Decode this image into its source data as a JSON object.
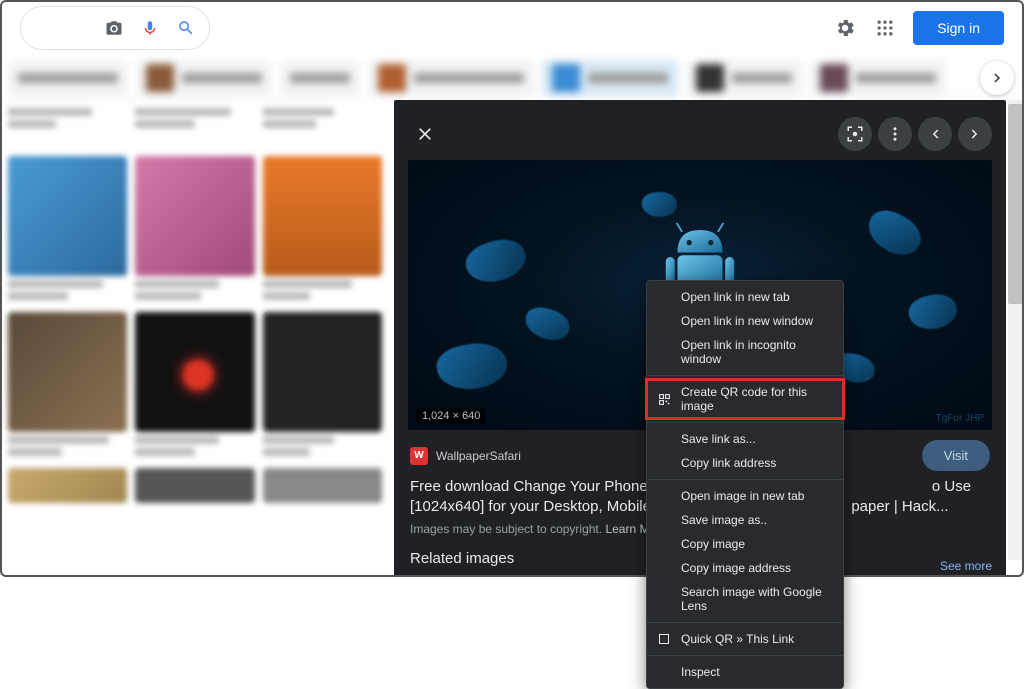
{
  "header": {
    "signin_label": "Sign in"
  },
  "viewer": {
    "dimensions": "1,024 × 640",
    "watermark": "TgFor JHP",
    "source": "WallpaperSafari",
    "favicon_letter": "W",
    "title_line1": "Free download Change Your Phones Boot Anim",
    "title_line2": "[1024x640] for your Desktop, Mobile & Tablet |",
    "title_suffix1": "o Use",
    "title_suffix2": "paper | Hack...",
    "copyright": "Images may be subject to copyright.",
    "learn_more": "Learn More",
    "related": "Related images",
    "seemore": "See more",
    "visit": "Visit"
  },
  "context_menu": {
    "items": [
      "Open link in new tab",
      "Open link in new window",
      "Open link in incognito window",
      "Create QR code for this image",
      "Save link as...",
      "Copy link address",
      "Open image in new tab",
      "Save image as..",
      "Copy image",
      "Copy image address",
      "Search image with Google Lens",
      "Quick QR » This Link",
      "Inspect"
    ]
  }
}
